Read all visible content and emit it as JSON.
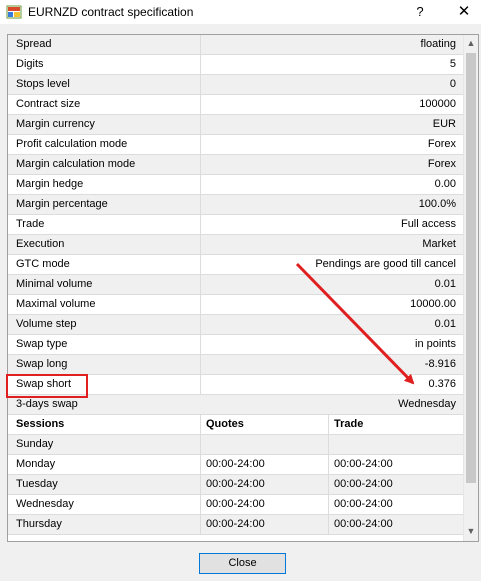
{
  "window": {
    "title": "EURNZD contract specification",
    "help_label": "?",
    "close_label": "✕"
  },
  "properties": [
    {
      "label": "Spread",
      "value": "floating"
    },
    {
      "label": "Digits",
      "value": "5"
    },
    {
      "label": "Stops level",
      "value": "0"
    },
    {
      "label": "Contract size",
      "value": "100000"
    },
    {
      "label": "Margin currency",
      "value": "EUR"
    },
    {
      "label": "Profit calculation mode",
      "value": "Forex"
    },
    {
      "label": "Margin calculation mode",
      "value": "Forex"
    },
    {
      "label": "Margin hedge",
      "value": "0.00"
    },
    {
      "label": "Margin percentage",
      "value": "100.0%"
    },
    {
      "label": "Trade",
      "value": "Full access"
    },
    {
      "label": "Execution",
      "value": "Market"
    },
    {
      "label": "GTC mode",
      "value": "Pendings are good till cancel"
    },
    {
      "label": "Minimal volume",
      "value": "0.01"
    },
    {
      "label": "Maximal volume",
      "value": "10000.00"
    },
    {
      "label": "Volume step",
      "value": "0.01"
    },
    {
      "label": "Swap type",
      "value": "in points"
    },
    {
      "label": "Swap long",
      "value": "-8.916"
    },
    {
      "label": "Swap short",
      "value": "0.376"
    },
    {
      "label": "3-days swap",
      "value": "Wednesday"
    }
  ],
  "sessions": {
    "headers": [
      "Sessions",
      "Quotes",
      "Trade"
    ],
    "rows": [
      {
        "day": "Sunday",
        "quotes": "",
        "trade": ""
      },
      {
        "day": "Monday",
        "quotes": "00:00-24:00",
        "trade": "00:00-24:00"
      },
      {
        "day": "Tuesday",
        "quotes": "00:00-24:00",
        "trade": "00:00-24:00"
      },
      {
        "day": "Wednesday",
        "quotes": "00:00-24:00",
        "trade": "00:00-24:00"
      },
      {
        "day": "Thursday",
        "quotes": "00:00-24:00",
        "trade": "00:00-24:00"
      }
    ]
  },
  "footer": {
    "close_button": "Close"
  },
  "colors": {
    "annotation": "#e02020",
    "button_border": "#0078d7"
  }
}
